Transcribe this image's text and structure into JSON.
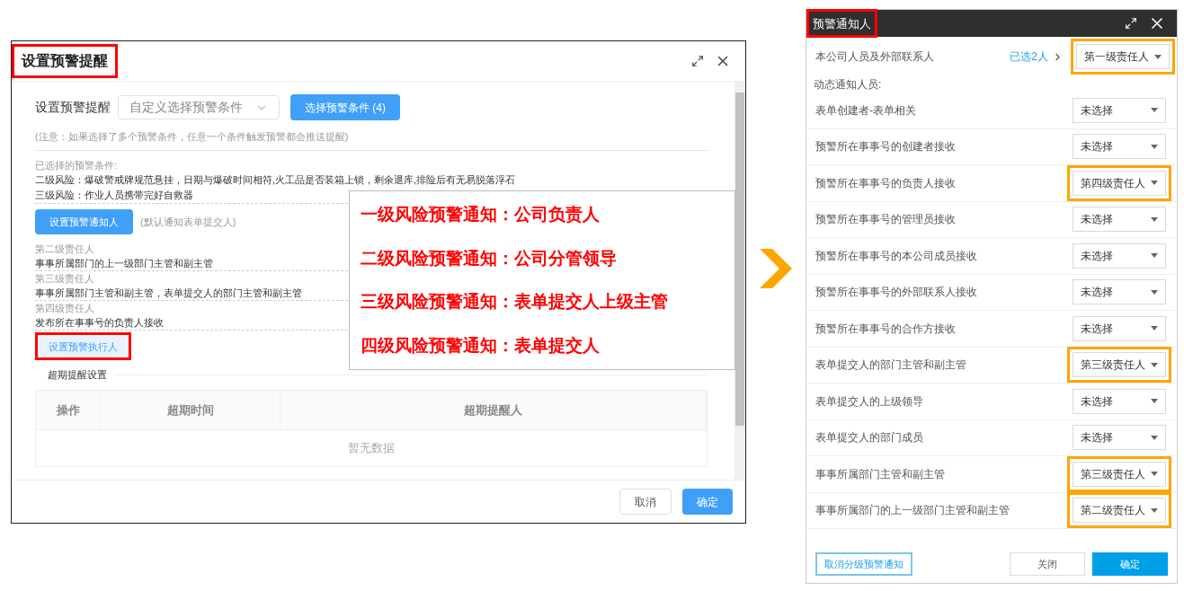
{
  "warning_dialog": {
    "title": "设置预警提醒",
    "title_highlighted": true,
    "setting_label": "设置预警提醒",
    "condition_select": "自定义选择预警条件",
    "select_conditions_button": "选择预警条件 (4)",
    "note": "(注意：如果选择了多个预警条件，任意一个条件触发预警都会推送提醒)",
    "selected_conditions_label": "已选择的预警条件:",
    "conditions": [
      "二级风险：爆破警戒牌规范悬挂，日期与爆破时间相符,火工品是否装箱上锁，剩余退库,排险后有无易脱落浮石",
      "三级风险：作业人员携带完好自救器"
    ],
    "notifier_button": "设置预警通知人",
    "notifier_hint": "(默认通知表单提交人)",
    "responsible_levels": [
      {
        "level": "第二级责任人",
        "value": "事事所属部门的上一级部门主管和副主管"
      },
      {
        "level": "第三级责任人",
        "value": "事事所属部门主管和副主管，表单提交人的部门主管和副主管"
      },
      {
        "level": "第四级责任人",
        "value": "发布所在事事号的负责人接收"
      }
    ],
    "executor_button": {
      "label": "设置预警执行人",
      "highlighted": true
    },
    "overdue_section": "超期提醒设置",
    "table": {
      "columns": [
        "操作",
        "超期时间",
        "超期提醒人"
      ],
      "empty_text": "暂无数据"
    },
    "buttons": {
      "cancel": "取消",
      "confirm": "确定"
    }
  },
  "annotation": {
    "lines": [
      "一级风险预警通知：公司负责人",
      "二级风险预警通知：公司分管领导",
      "三级风险预警通知：表单提交人上级主管",
      "四级风险预警通知：表单提交人"
    ]
  },
  "notifier_panel": {
    "title": "预警通知人",
    "title_highlighted": true,
    "company_row": {
      "label": "本公司人员及外部联系人",
      "selected_link": "已选2人",
      "value": "第一级责任人",
      "highlighted": true
    },
    "dynamic_label": "动态通知人员:",
    "rows": [
      {
        "label": "表单创建者-表单相关",
        "value": "未选择",
        "highlighted": false
      },
      {
        "label": "预警所在事事号的创建者接收",
        "value": "未选择",
        "highlighted": false
      },
      {
        "label": "预警所在事事号的负责人接收",
        "value": "第四级责任人",
        "highlighted": true
      },
      {
        "label": "预警所在事事号的管理员接收",
        "value": "未选择",
        "highlighted": false
      },
      {
        "label": "预警所在事事号的本公司成员接收",
        "value": "未选择",
        "highlighted": false
      },
      {
        "label": "预警所在事事号的外部联系人接收",
        "value": "未选择",
        "highlighted": false
      },
      {
        "label": "预警所在事事号的合作方接收",
        "value": "未选择",
        "highlighted": false
      },
      {
        "label": "表单提交人的部门主管和副主管",
        "value": "第三级责任人",
        "highlighted": true
      },
      {
        "label": "表单提交人的上级领导",
        "value": "未选择",
        "highlighted": false
      },
      {
        "label": "表单提交人的部门成员",
        "value": "未选择",
        "highlighted": false
      },
      {
        "label": "事事所属部门主管和副主管",
        "value": "第三级责任人",
        "highlighted": true
      },
      {
        "label": "事事所属部门的上一级部门主管和副主管",
        "value": "第二级责任人",
        "highlighted": true
      }
    ],
    "buttons": {
      "cancel_grading": "取消分级预警通知",
      "close": "关闭",
      "confirm": "确定"
    }
  }
}
